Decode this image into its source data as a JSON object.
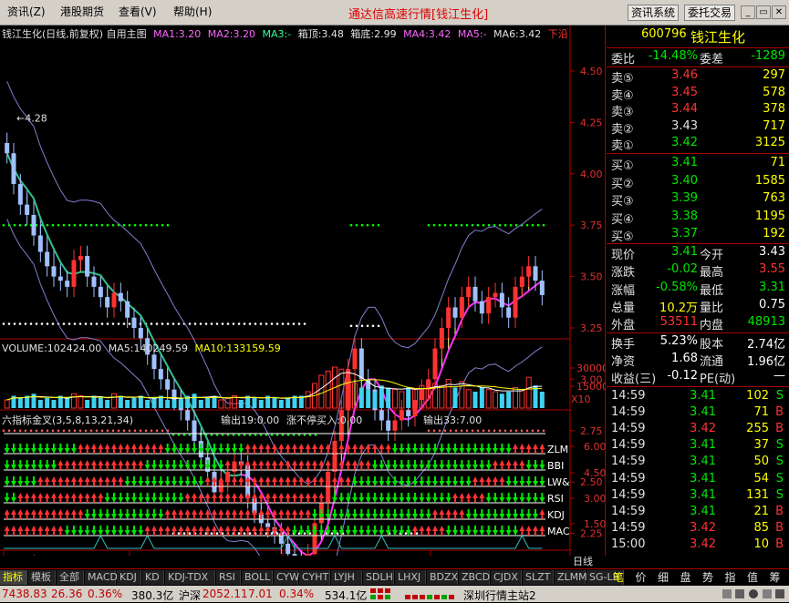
{
  "menu": {
    "items": [
      "资讯(Z)",
      "港股期货",
      "查看(V)",
      "帮助(H)"
    ]
  },
  "title": "通达信高速行情[钱江生化]",
  "sys_buttons": {
    "info": "资讯系统",
    "trade": "委托交易"
  },
  "chart_header": {
    "stock": "钱江生化(日线,前复权) 自用主图",
    "ma1": "MA1:3.20",
    "ma2": "MA2:3.20",
    "ma3": "MA3:-",
    "box_top": "箱顶:3.48",
    "box_bottom": "箱底:2.99",
    "ma4": "MA4:3.42",
    "ma5": "MA5:-",
    "ma6": "MA6:3.42",
    "dir": "下沿"
  },
  "price_axis": [
    "4.50",
    "4.25",
    "4.00",
    "3.75",
    "3.50",
    "3.25",
    "3.00",
    "2.75",
    "2.50",
    "2.25",
    "2.00"
  ],
  "price_annotations": {
    "high": "4.28",
    "low": "2.04"
  },
  "volume_header": {
    "vol": "VOLUME:102424.00",
    "ma5": "MA5:140249.59",
    "ma10": "MA10:133159.59"
  },
  "volume_axis": [
    "30000",
    "15000",
    "X10"
  ],
  "indicator_header": {
    "name": "六指标金叉(3,5,8,13,21,34)",
    "out1": "输出19:0.00",
    "out2": "涨不停买入:0.00",
    "out3": "输出33:7.00"
  },
  "indicator_rows": [
    "ZLM",
    "BBI",
    "LW&",
    "RSI",
    "KDJ",
    "MAC"
  ],
  "indicator_axis": [
    "6.00",
    "4.50",
    "3.00",
    "1.50"
  ],
  "date_axis": [
    "2008年",
    "10",
    "11",
    "12"
  ],
  "period": "日线",
  "quote": {
    "code": "600796",
    "name": "钱江生化",
    "weibi_label": "委比",
    "weibi": "-14.48%",
    "weicha_label": "委差",
    "weicha": "-1289",
    "asks": [
      {
        "label": "卖⑤",
        "price": "3.46",
        "vol": "297"
      },
      {
        "label": "卖④",
        "price": "3.45",
        "vol": "578"
      },
      {
        "label": "卖③",
        "price": "3.44",
        "vol": "378"
      },
      {
        "label": "卖②",
        "price": "3.43",
        "vol": "717"
      },
      {
        "label": "卖①",
        "price": "3.42",
        "vol": "3125"
      }
    ],
    "bids": [
      {
        "label": "买①",
        "price": "3.41",
        "vol": "71"
      },
      {
        "label": "买②",
        "price": "3.40",
        "vol": "1585"
      },
      {
        "label": "买③",
        "price": "3.39",
        "vol": "763"
      },
      {
        "label": "买④",
        "price": "3.38",
        "vol": "1195"
      },
      {
        "label": "买⑤",
        "price": "3.37",
        "vol": "192"
      }
    ],
    "stats": [
      {
        "l1": "现价",
        "v1": "3.41",
        "l2": "今开",
        "v2": "3.43"
      },
      {
        "l1": "涨跌",
        "v1": "-0.02",
        "l2": "最高",
        "v2": "3.55"
      },
      {
        "l1": "涨幅",
        "v1": "-0.58%",
        "l2": "最低",
        "v2": "3.31"
      },
      {
        "l1": "总量",
        "v1": "10.2万",
        "l2": "量比",
        "v2": "0.75"
      },
      {
        "l1": "外盘",
        "v1": "53511",
        "l2": "内盘",
        "v2": "48913"
      }
    ],
    "fund": [
      {
        "l1": "换手",
        "v1": "5.23%",
        "l2": "股本",
        "v2": "2.74亿"
      },
      {
        "l1": "净资",
        "v1": "1.68",
        "l2": "流通",
        "v2": "1.96亿"
      },
      {
        "l1": "收益(三)",
        "v1": "-0.12",
        "l2": "PE(动)",
        "v2": "—"
      }
    ],
    "ticks": [
      {
        "t": "14:59",
        "p": "3.41",
        "v": "102",
        "f": "S"
      },
      {
        "t": "14:59",
        "p": "3.41",
        "v": "71",
        "f": "B"
      },
      {
        "t": "14:59",
        "p": "3.42",
        "v": "255",
        "f": "B"
      },
      {
        "t": "14:59",
        "p": "3.41",
        "v": "37",
        "f": "S"
      },
      {
        "t": "14:59",
        "p": "3.41",
        "v": "50",
        "f": "S"
      },
      {
        "t": "14:59",
        "p": "3.41",
        "v": "54",
        "f": "S"
      },
      {
        "t": "14:59",
        "p": "3.41",
        "v": "131",
        "f": "S"
      },
      {
        "t": "14:59",
        "p": "3.41",
        "v": "21",
        "f": "B"
      },
      {
        "t": "14:59",
        "p": "3.42",
        "v": "85",
        "f": "B"
      },
      {
        "t": "15:00",
        "p": "3.42",
        "v": "10",
        "f": "B"
      }
    ]
  },
  "bottom_tabs": [
    "指标",
    "模板",
    "全部",
    "MACD",
    "KDJ",
    "KD",
    "KDJ-TDX",
    "RSI",
    "BOLL",
    "CYW",
    "CYHT",
    "LYJH",
    "SDLH",
    "LHXJ",
    "BDZX",
    "ZBCD",
    "CJDX",
    "SLZT",
    "ZLMM",
    "SG-LB"
  ],
  "right_tabs": [
    "笔",
    "价",
    "细",
    "盘",
    "势",
    "指",
    "值",
    "筹"
  ],
  "status": {
    "sh_index": "7438.83",
    "sh_chg": "26.36",
    "sh_pct": "0.36%",
    "sh_amt": "380.3亿",
    "sz_label": "沪深",
    "sz_index": "2052.11",
    "sz_chg": "7.01",
    "sz_pct": "0.34%",
    "sz_amt": "534.1亿",
    "server": "深圳行情主站2"
  },
  "colors": {
    "up": "#ff3232",
    "down": "#00e600",
    "yellow": "#ffff00",
    "bg": "#000000"
  }
}
